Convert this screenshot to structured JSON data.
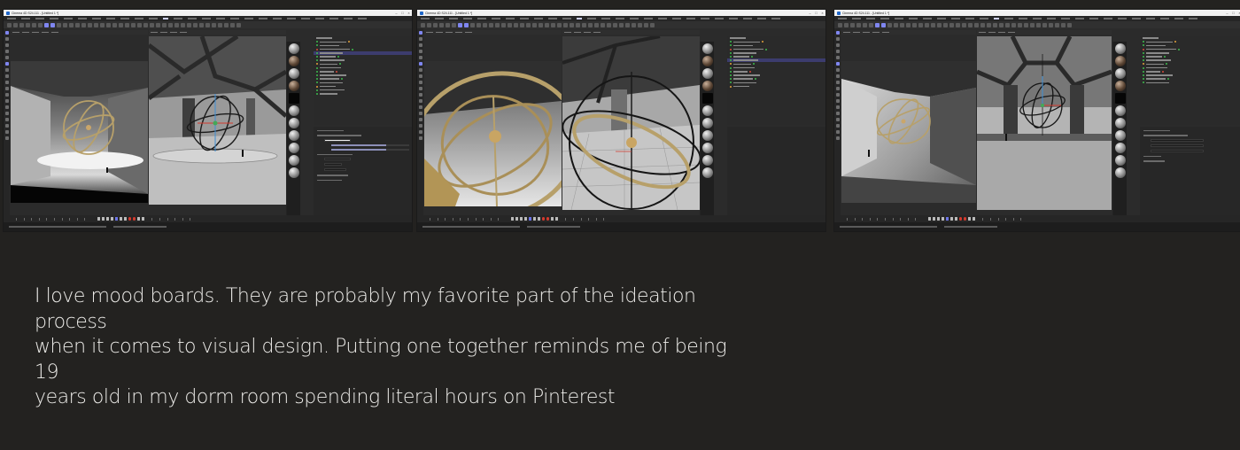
{
  "caption": {
    "line1": "I love mood boards. They are probably my favorite part of the ideation process",
    "line2": "when it comes to visual design. Putting one together reminds me of being 19",
    "line3": "years old in my dorm room spending literal hours on Pinterest"
  },
  "screenshots": [
    {
      "titlebar": "Cinema 4D S24.111 - [Untitled 1 *]"
    },
    {
      "titlebar": "Cinema 4D S24.111 - [Untitled 1 *]"
    },
    {
      "titlebar": "Cinema 4D S24.111 - [Untitled 1 *]"
    }
  ],
  "colors": {
    "background": "#232220",
    "caption_text": "#ecebe8",
    "ui_dark": "#2b2b2b",
    "accent": "#7f86f0",
    "gold_ring": "#b7a06a"
  }
}
